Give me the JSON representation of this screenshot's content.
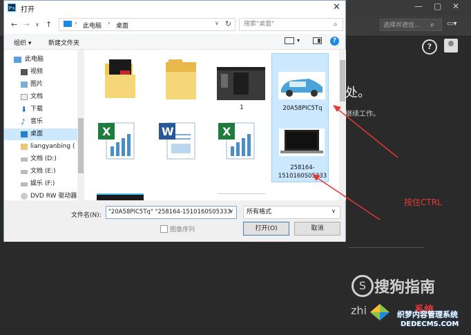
{
  "photoshop": {
    "search_placeholder": "选择并遮住...",
    "welcome_title": "处。",
    "welcome_sub": "继续工作。",
    "help_label": "?"
  },
  "dialog": {
    "title": "打开",
    "app_icon_text": "Ps",
    "close_label": "✕"
  },
  "address": {
    "crumbs": [
      "此电脑",
      "桌面"
    ],
    "search_placeholder": "搜索\"桌面\""
  },
  "toolbar": {
    "organize": "组织 ▾",
    "new_folder": "新建文件夹"
  },
  "nav": {
    "items": [
      {
        "label": "此电脑",
        "icon": "computer-icon"
      },
      {
        "label": "视频",
        "icon": "video-folder-icon"
      },
      {
        "label": "图片",
        "icon": "picture-folder-icon"
      },
      {
        "label": "文档",
        "icon": "document-folder-icon"
      },
      {
        "label": "下载",
        "icon": "download-folder-icon"
      },
      {
        "label": "音乐",
        "icon": "music-folder-icon"
      },
      {
        "label": "桌面",
        "icon": "desktop-folder-icon"
      },
      {
        "label": "liangyanbing (",
        "icon": "user-folder-icon"
      },
      {
        "label": "文档 (D:)",
        "icon": "drive-icon"
      },
      {
        "label": "文档 (E:)",
        "icon": "drive-icon"
      },
      {
        "label": "娱乐 (F:)",
        "icon": "drive-icon"
      },
      {
        "label": "DVD RW 驱动器",
        "icon": "dvd-drive-icon"
      }
    ],
    "selected": "桌面"
  },
  "files": [
    {
      "label": "",
      "type": "folder-red"
    },
    {
      "label": "",
      "type": "folder"
    },
    {
      "label": "1",
      "type": "screenshot"
    },
    {
      "label": "20A58PIC5Tq",
      "type": "car-image"
    },
    {
      "label": "",
      "type": "excel"
    },
    {
      "label": "",
      "type": "word"
    },
    {
      "label": "",
      "type": "excel"
    },
    {
      "label": "258164-1510160S05333",
      "type": "laptop-image"
    }
  ],
  "bottom": {
    "filename_label": "文件名(N):",
    "filename_value": "\"20A58PIC5Tq\" \"258164-1510160S05333",
    "filter_value": "所有格式",
    "sequence_label": "图像序列",
    "open_label": "打开(O)",
    "cancel_label": "取消"
  },
  "annotation": {
    "text": "按住CTRL",
    "color": "#e53935"
  },
  "watermarks": {
    "sogou": "搜狗指南",
    "zhi": "zhi",
    "site_a": "系统之家",
    "site_b": "系统",
    "site_c": "DEDECMS.COM",
    "site_d": "织梦内容管理系统"
  }
}
